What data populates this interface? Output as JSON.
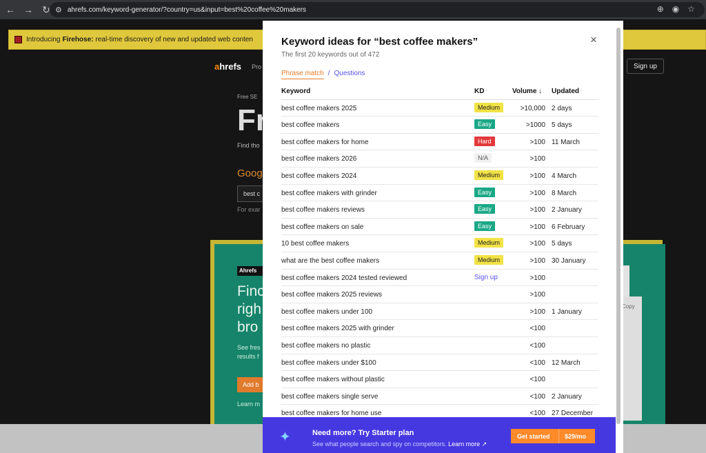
{
  "browser": {
    "url": "ahrefs.com/keyword-generator/?country=us&input=best%20coffee%20makers"
  },
  "background": {
    "announcement_prefix": "Introducing",
    "announcement_bold": "Firehose:",
    "announcement_rest": "real-time discovery of new and updated web conten",
    "logo_a": "a",
    "logo_rest": "hrefs",
    "nav_partial": "Pro",
    "signup_label": "Sign up",
    "free_partial": "Free SE",
    "big_partial": "Fr",
    "find_partial": "Find tho",
    "google_partial": "Goog",
    "input_partial": "best c",
    "for_example_partial": "For exar",
    "ahrefs_badge": "Ahrefs",
    "hero_lines": [
      "Finc",
      "righ",
      "bro"
    ],
    "see_lines": [
      "See fres",
      "results f"
    ],
    "add_partial": "Add b",
    "learn_partial": "Learn m",
    "copy_partial": "Copy"
  },
  "modal": {
    "title": "Keyword ideas for “best coffee makers”",
    "subtitle": "The first 20 keywords out of 472",
    "close_glyph": "×",
    "tabs": {
      "active": "Phrase match",
      "separator": "/",
      "other": "Questions"
    },
    "headers": {
      "keyword": "Keyword",
      "kd": "KD",
      "kd_marker": "ⁱ",
      "volume": "Volume",
      "volume_sort": "↓",
      "updated": "Updated",
      "updated_marker": "ⁱ"
    },
    "rows": [
      {
        "keyword": "best coffee makers 2025",
        "kd": "Medium",
        "kd_type": "medium",
        "volume": ">10,000",
        "updated": "2 days"
      },
      {
        "keyword": "best coffee makers",
        "kd": "Easy",
        "kd_type": "easy",
        "volume": ">1000",
        "updated": "5 days"
      },
      {
        "keyword": "best coffee makers for home",
        "kd": "Hard",
        "kd_type": "hard",
        "volume": ">100",
        "updated": "11 March"
      },
      {
        "keyword": "best coffee makers 2026",
        "kd": "N/A",
        "kd_type": "na",
        "volume": ">100",
        "updated": ""
      },
      {
        "keyword": "best coffee makers 2024",
        "kd": "Medium",
        "kd_type": "medium",
        "volume": ">100",
        "updated": "4 March"
      },
      {
        "keyword": "best coffee makers with grinder",
        "kd": "Easy",
        "kd_type": "easy",
        "volume": ">100",
        "updated": "8 March"
      },
      {
        "keyword": "best coffee makers reviews",
        "kd": "Easy",
        "kd_type": "easy",
        "volume": ">100",
        "updated": "2 January"
      },
      {
        "keyword": "best coffee makers on sale",
        "kd": "Easy",
        "kd_type": "easy",
        "volume": ">100",
        "updated": "6 February"
      },
      {
        "keyword": "10 best coffee makers",
        "kd": "Medium",
        "kd_type": "medium",
        "volume": ">100",
        "updated": "5 days"
      },
      {
        "keyword": "what are the best coffee makers",
        "kd": "Medium",
        "kd_type": "medium",
        "volume": ">100",
        "updated": "30 January"
      },
      {
        "keyword": "best coffee makers 2024 tested reviewed",
        "kd": "Sign up",
        "kd_type": "signup",
        "volume": ">100",
        "updated": ""
      },
      {
        "keyword": "best coffee makers 2025 reviews",
        "kd": "",
        "kd_type": "none",
        "volume": ">100",
        "updated": ""
      },
      {
        "keyword": "best coffee makers under 100",
        "kd": "",
        "kd_type": "none",
        "volume": ">100",
        "updated": "1 January"
      },
      {
        "keyword": "best coffee makers 2025 with grinder",
        "kd": "",
        "kd_type": "none",
        "volume": "<100",
        "updated": ""
      },
      {
        "keyword": "best coffee makers no plastic",
        "kd": "",
        "kd_type": "none",
        "volume": "<100",
        "updated": ""
      },
      {
        "keyword": "best coffee makers under $100",
        "kd": "",
        "kd_type": "none",
        "volume": "<100",
        "updated": "12 March"
      },
      {
        "keyword": "best coffee makers without plastic",
        "kd": "",
        "kd_type": "none",
        "volume": "<100",
        "updated": ""
      },
      {
        "keyword": "best coffee makers single serve",
        "kd": "",
        "kd_type": "none",
        "volume": "<100",
        "updated": "2 January"
      },
      {
        "keyword": "best coffee makers for home use",
        "kd": "",
        "kd_type": "none",
        "volume": "<100",
        "updated": "27 December"
      }
    ],
    "footer": {
      "title": "Need more? Try Starter plan",
      "subtitle": "See what people search and spy on competitors.",
      "learn_more": "Learn more ↗",
      "cta_label": "Get started",
      "cta_price": "$29/mo"
    }
  },
  "colors": {
    "accent_orange": "#e67c27",
    "link_purple": "#5850ec",
    "badge_medium": "#f2e246",
    "badge_easy": "#1aa886",
    "badge_hard": "#e3393b",
    "footer_bg": "#4638e0"
  }
}
